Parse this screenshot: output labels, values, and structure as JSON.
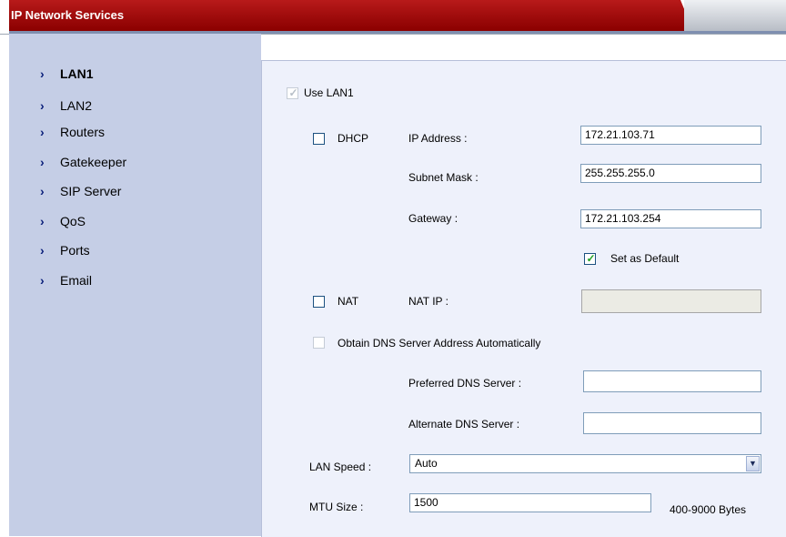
{
  "header": {
    "title": "IP Network Services"
  },
  "sidebar": {
    "items": [
      {
        "label": "LAN1"
      },
      {
        "label": "LAN2"
      },
      {
        "label": "Routers"
      },
      {
        "label": "Gatekeeper"
      },
      {
        "label": "SIP Server"
      },
      {
        "label": "QoS"
      },
      {
        "label": "Ports"
      },
      {
        "label": "Email"
      }
    ]
  },
  "form": {
    "use_lan1": {
      "label": "Use LAN1",
      "checked": true,
      "disabled": true
    },
    "dhcp": {
      "label": "DHCP",
      "checked": false
    },
    "ip_address": {
      "label": "IP Address :",
      "value": "172.21.103.71"
    },
    "subnet_mask": {
      "label": "Subnet Mask :",
      "value": "255.255.255.0"
    },
    "gateway": {
      "label": "Gateway :",
      "value": "172.21.103.254"
    },
    "set_as_default": {
      "label": "Set as Default",
      "checked": true
    },
    "nat": {
      "label": "NAT",
      "checked": false
    },
    "nat_ip": {
      "label": "NAT IP :",
      "value": ""
    },
    "obtain_dns": {
      "label": "Obtain DNS Server Address Automatically",
      "checked": false,
      "disabled": true
    },
    "preferred_dns": {
      "label": "Preferred DNS Server :",
      "value": ""
    },
    "alternate_dns": {
      "label": "Alternate DNS Server :",
      "value": ""
    },
    "lan_speed": {
      "label": "LAN Speed :",
      "value": "Auto"
    },
    "mtu_size": {
      "label": "MTU Size :",
      "value": "1500",
      "hint": "400-9000 Bytes"
    }
  },
  "icons": {
    "nav_chevron": "chevron-right-icon",
    "check": "checkmark-icon",
    "dropdown": "dropdown-arrow-icon"
  },
  "colors": {
    "title_bar": "#9c0a0a",
    "sidebar_bg": "#c5cee6",
    "panel_bg": "#eef1fb",
    "checkmark": "#21a121"
  }
}
